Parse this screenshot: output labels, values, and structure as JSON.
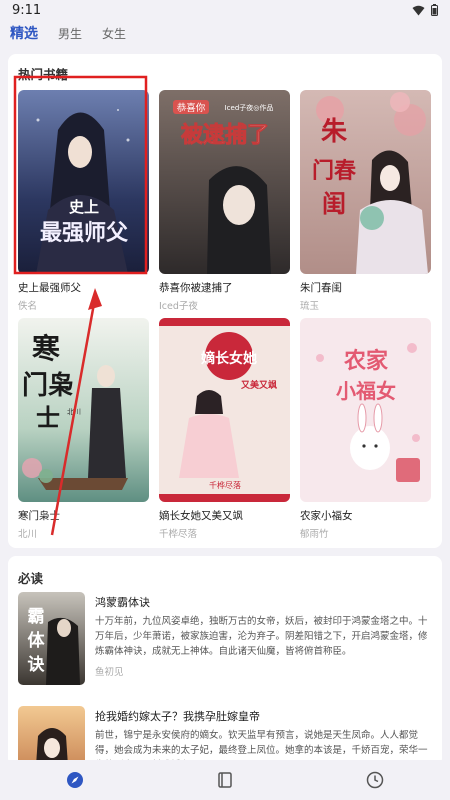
{
  "status_bar": {
    "time": "9:11",
    "icons": [
      "wifi-icon",
      "battery-icon"
    ]
  },
  "tabs": [
    {
      "label": "精选",
      "active": true
    },
    {
      "label": "男生",
      "active": false
    },
    {
      "label": "女生",
      "active": false
    }
  ],
  "hot_books": {
    "title": "热门书籍",
    "books": [
      {
        "title": "史上最强师父",
        "author": "佚名",
        "cover_text": [
          "史上",
          "最强师父"
        ],
        "cover_color": "#3b4a7a"
      },
      {
        "title": "恭喜你被逮捕了",
        "author": "Iced子夜",
        "cover_text": [
          "恭喜你",
          "Iced子夜◎作品",
          "被逮捕了"
        ],
        "cover_color": "#5a5050"
      },
      {
        "title": "朱门春闺",
        "author": "琉玉",
        "cover_text": [
          "朱",
          "门春",
          "闺"
        ],
        "cover_color": "#c8a7a7"
      },
      {
        "title": "寒门枭士",
        "author": "北川",
        "cover_text": [
          "寒",
          "门枭",
          "士",
          "北川"
        ],
        "cover_color": "#7fa89a"
      },
      {
        "title": "嫡长女她又美又飒",
        "author": "千桦尽落",
        "cover_text": [
          "嫡长女她",
          "又美又飒",
          "千桦尽落"
        ],
        "cover_color": "#e9d7d4"
      },
      {
        "title": "农家小福女",
        "author": "郁雨竹",
        "cover_text": [
          "农家",
          "小福女"
        ],
        "cover_color": "#f6e6ea"
      }
    ]
  },
  "must_read": {
    "title": "必读",
    "items": [
      {
        "title": "鸿蒙霸体诀",
        "desc": "十万年前，九位风姿卓绝，独断万古的女帝，妖后，被封印于鸿蒙金塔之中。十万年后，少年萧诺，被家族迫害，沦为弃子。阴差阳错之下，开启鸿蒙金塔，修炼霸体神诀，成就无上神体。自此诸天仙魔，皆将俯首称臣。",
        "author": "鱼初见",
        "cover_text": [
          "霸",
          "体",
          "诀"
        ]
      },
      {
        "title": "抢我婚约嫁太子？我携孕肚嫁皇帝",
        "desc": "前世，锦宁是永安侯府的嫡女。钦天监早有预言，说她是天生凤命。人人都觉得，她会成为未来的太子妃，最终登上凤位。她拿的本该是，千娇百宠，荣华一生的剧本。不料成婚在即，",
        "author": "",
        "cover_text": []
      }
    ]
  },
  "bottom_nav": [
    {
      "icon": "compass-icon",
      "active": true
    },
    {
      "icon": "bookshelf-icon",
      "active": false
    },
    {
      "icon": "clock-icon",
      "active": false
    }
  ],
  "colors": {
    "accent": "#2f57c2",
    "highlight_box": "#e02020",
    "arrow": "#d92b2b"
  }
}
